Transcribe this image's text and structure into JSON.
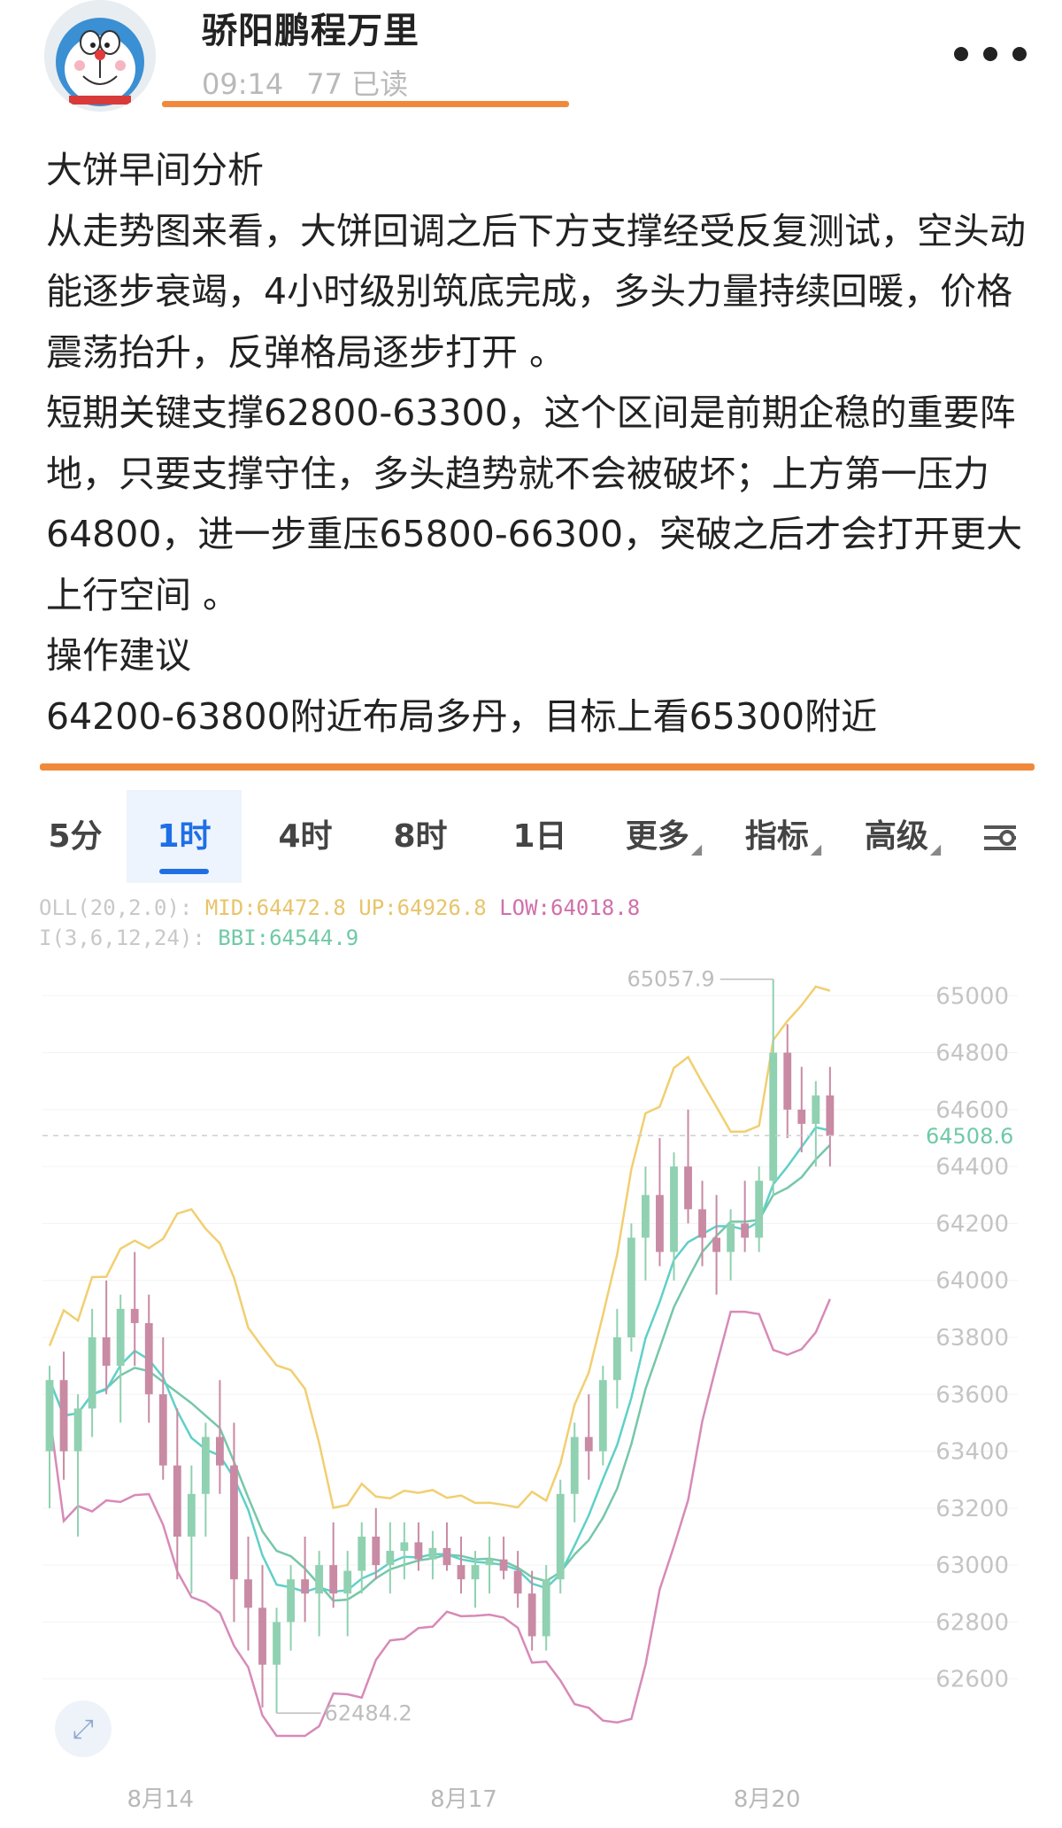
{
  "post": {
    "author": "骄阳鹏程万里",
    "time": "09:14",
    "reads": "77 已读",
    "more_icon": "more-dots-icon"
  },
  "article": {
    "paragraphs": [
      "大饼早间分析",
      "从走势图来看，大饼回调之后下方支撑经受反复测试，空头动能逐步衰竭，4小时级别筑底完成，多头力量持续回暖，价格震荡抬升，反弹格局逐步打开 。",
      "短期关键支撑62800-63300，这个区间是前期企稳的重要阵地，只要支撑守住，多头趋势就不会被破坏；上方第一压力64800，进一步重压65800-66300，突破之后才会打开更大上行空间 。",
      "操作建议",
      "64200-63800附近布局多丹，目标上看65300附近"
    ]
  },
  "chart": {
    "tabs": [
      {
        "label": "5分",
        "active": false
      },
      {
        "label": "1时",
        "active": true
      },
      {
        "label": "4时",
        "active": false
      },
      {
        "label": "8时",
        "active": false
      },
      {
        "label": "1日",
        "active": false
      },
      {
        "label": "更多",
        "active": false,
        "caret": true
      },
      {
        "label": "指标",
        "active": false,
        "caret": true
      },
      {
        "label": "高级",
        "active": false,
        "caret": true
      }
    ],
    "settings_icon": "settings-sliders-icon",
    "boll": {
      "label": "OLL(20,2.0):",
      "mid": "MID:64472.8",
      "up": "UP:64926.8",
      "low": "LOW:64018.8"
    },
    "bbi": {
      "label": "I(3,6,12,24):",
      "value": "BBI:64544.9"
    },
    "high_label": "65057.9",
    "low_label": "62484.2",
    "current_price": "64508.6",
    "zoom_icon": "expand-arrows-icon",
    "colors": {
      "up_candle": "#8fd1b1",
      "down_candle": "#c98aa4",
      "boll_up": "#f1cf71",
      "boll_low": "#d78ab8",
      "mid_line": "#76c7a8",
      "bbi_line": "#5fd0c8",
      "accent": "#1e6fe6"
    }
  },
  "chart_data": {
    "type": "candlestick",
    "title": "",
    "interval": "1时",
    "ylim": [
      62400,
      65200
    ],
    "y_ticks": [
      65000,
      64800,
      64600,
      64400,
      64200,
      64000,
      63800,
      63600,
      63400,
      63200,
      63000,
      62800,
      62600
    ],
    "x_tick_labels": [
      "8月14",
      "8月17",
      "8月20"
    ],
    "current_price": 64508.6,
    "high_marker": 65057.9,
    "low_marker": 62484.2,
    "candles": [
      [
        63400,
        63700,
        63200,
        63650
      ],
      [
        63650,
        63750,
        63300,
        63400
      ],
      [
        63400,
        63600,
        63100,
        63550
      ],
      [
        63550,
        63900,
        63450,
        63800
      ],
      [
        63800,
        64000,
        63600,
        63700
      ],
      [
        63700,
        63950,
        63500,
        63900
      ],
      [
        63900,
        64100,
        63700,
        63850
      ],
      [
        63850,
        63950,
        63500,
        63600
      ],
      [
        63600,
        63800,
        63300,
        63350
      ],
      [
        63350,
        63550,
        62950,
        63100
      ],
      [
        63100,
        63350,
        62900,
        63250
      ],
      [
        63250,
        63500,
        63100,
        63450
      ],
      [
        63450,
        63650,
        63250,
        63350
      ],
      [
        63350,
        63500,
        62800,
        62950
      ],
      [
        62950,
        63100,
        62700,
        62850
      ],
      [
        62850,
        63000,
        62500,
        62650
      ],
      [
        62650,
        62850,
        62480,
        62800
      ],
      [
        62800,
        63000,
        62700,
        62950
      ],
      [
        62950,
        63100,
        62800,
        62900
      ],
      [
        62900,
        63050,
        62750,
        63000
      ],
      [
        63000,
        63150,
        62850,
        62900
      ],
      [
        62900,
        63050,
        62750,
        62980
      ],
      [
        62980,
        63150,
        62900,
        63100
      ],
      [
        63100,
        63200,
        62950,
        63000
      ],
      [
        63000,
        63150,
        62900,
        63050
      ],
      [
        63050,
        63150,
        62950,
        63080
      ],
      [
        63080,
        63150,
        62980,
        63020
      ],
      [
        63020,
        63120,
        62950,
        63060
      ],
      [
        63060,
        63150,
        62980,
        63000
      ],
      [
        63000,
        63100,
        62900,
        62950
      ],
      [
        62950,
        63050,
        62850,
        63000
      ],
      [
        63000,
        63100,
        62900,
        63020
      ],
      [
        63020,
        63100,
        62950,
        62980
      ],
      [
        62980,
        63050,
        62850,
        62900
      ],
      [
        62900,
        62980,
        62700,
        62750
      ],
      [
        62750,
        63000,
        62700,
        62950
      ],
      [
        62950,
        63300,
        62900,
        63250
      ],
      [
        63250,
        63500,
        63150,
        63450
      ],
      [
        63450,
        63600,
        63300,
        63400
      ],
      [
        63400,
        63700,
        63350,
        63650
      ],
      [
        63650,
        63900,
        63550,
        63800
      ],
      [
        63800,
        64200,
        63750,
        64150
      ],
      [
        64150,
        64400,
        64000,
        64300
      ],
      [
        64300,
        64500,
        64050,
        64100
      ],
      [
        64100,
        64450,
        64000,
        64400
      ],
      [
        64400,
        64600,
        64200,
        64250
      ],
      [
        64250,
        64350,
        64050,
        64150
      ],
      [
        64150,
        64300,
        63950,
        64100
      ],
      [
        64100,
        64250,
        64000,
        64200
      ],
      [
        64200,
        64350,
        64100,
        64150
      ],
      [
        64150,
        64400,
        64100,
        64350
      ],
      [
        64350,
        65058,
        64300,
        64800
      ],
      [
        64800,
        64900,
        64500,
        64600
      ],
      [
        64600,
        64750,
        64450,
        64550
      ],
      [
        64550,
        64700,
        64400,
        64650
      ],
      [
        64650,
        64750,
        64400,
        64508
      ]
    ]
  }
}
